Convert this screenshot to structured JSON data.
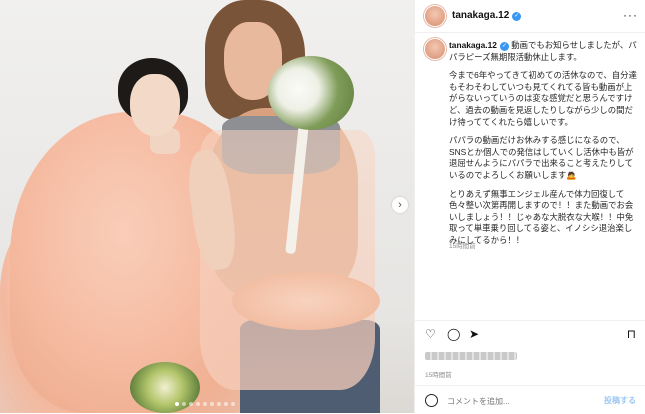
{
  "header": {
    "username": "tanakaga.12",
    "more_label": "···"
  },
  "caption": {
    "username": "tanakaga.12",
    "paragraphs": [
      "動画でもお知らせしましたが、パパラピーズ無期限活動休止します。",
      "今まで6年やってきて初めての活休なので、自分達もそわそわしていつも見てくれてる皆も動画が上がらないっていうのは変な感覚だと思うんですけど、過去の動画を見返したりしながら少しの間だけ待っててくれたら嬉しいです。",
      "パパラの動画だけお休みする感じになるので、SNSとか個人での発信はしていくし活休中も皆が退屈せんようにパパラで出来ること考えたりしているのでよろしくお願いします🙇",
      "とりあえず無事エンジェル産んで体力回復して色々整い次第再開しますので！！また動画でお会いしましょう！！じゃあな大脱衣な大喉！！中免取って単車乗り回してる姿と、イノシシ退治楽しみにしてるから！！"
    ],
    "time": "15時間前"
  },
  "footer": {
    "time": "15時間前"
  },
  "comment": {
    "placeholder": "コメントを追加...",
    "post_label": "投稿する"
  },
  "icons": {
    "more": "more-options-icon",
    "like": "heart-icon",
    "comment": "comment-icon",
    "share": "share-icon",
    "save": "bookmark-icon",
    "next": "chevron-right-icon",
    "emoji": "emoji-icon"
  },
  "carousel": {
    "count": 9,
    "active": 1
  },
  "colors": {
    "accent": "#3897f0",
    "post_button": "#9fc8f2"
  }
}
